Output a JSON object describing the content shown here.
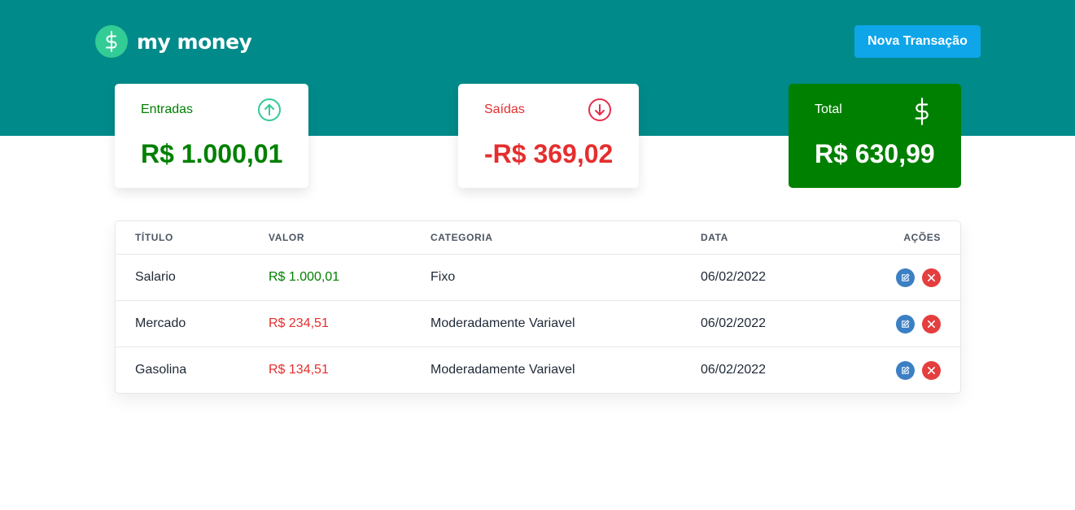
{
  "header": {
    "logo_text": "my money",
    "new_transaction_label": "Nova Transação",
    "colors": {
      "background": "#008a8a",
      "logo_circle": "#33cc95",
      "button": "#0ea5e9"
    },
    "logo_icon": "dollar-icon"
  },
  "summary": {
    "income": {
      "label": "Entradas",
      "value": "R$ 1.000,01",
      "color": "#008000",
      "icon": "arrow-up-circle-icon"
    },
    "outcome": {
      "label": "Saídas",
      "value": "-R$ 369,02",
      "color": "#e52e4d",
      "icon": "arrow-down-circle-icon"
    },
    "total": {
      "label": "Total",
      "value": "R$ 630,99",
      "background": "#008000",
      "icon": "dollar-icon"
    }
  },
  "table": {
    "headers": {
      "title": "TÍTULO",
      "value": "VALOR",
      "category": "CATEGORIA",
      "date": "DATA",
      "actions": "AÇÕES"
    },
    "rows": [
      {
        "title": "Salario",
        "value": "R$ 1.000,01",
        "type": "income",
        "category": "Fixo",
        "date": "06/02/2022"
      },
      {
        "title": "Mercado",
        "value": "R$ 234,51",
        "type": "outcome",
        "category": "Moderadamente Variavel",
        "date": "06/02/2022"
      },
      {
        "title": "Gasolina",
        "value": "R$ 134,51",
        "type": "outcome",
        "category": "Moderadamente Variavel",
        "date": "06/02/2022"
      }
    ],
    "value_colors": {
      "income": "#008000",
      "outcome": "#e52e2e"
    },
    "action_icons": {
      "edit": "edit-icon",
      "delete": "close-icon"
    }
  }
}
